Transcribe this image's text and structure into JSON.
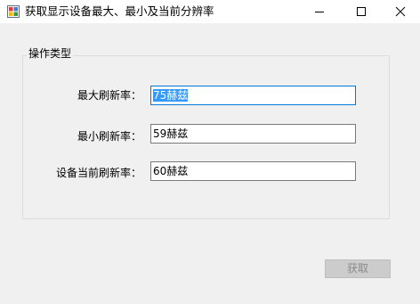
{
  "window": {
    "title": "获取显示设备最大、最小及当前分辨率"
  },
  "group": {
    "legend": "操作类型"
  },
  "rows": [
    {
      "label": "最大刷新率：",
      "value": "75赫兹",
      "selected": true
    },
    {
      "label": "最小刷新率：",
      "value": "59赫兹",
      "selected": false
    },
    {
      "label": "设备当前刷新率：",
      "value": "60赫兹",
      "selected": false
    }
  ],
  "actions": {
    "get_label": "获取"
  },
  "colors": {
    "selection": "#3399ff",
    "focus_border": "#0078d7",
    "window_bg": "#f0f0f0"
  }
}
